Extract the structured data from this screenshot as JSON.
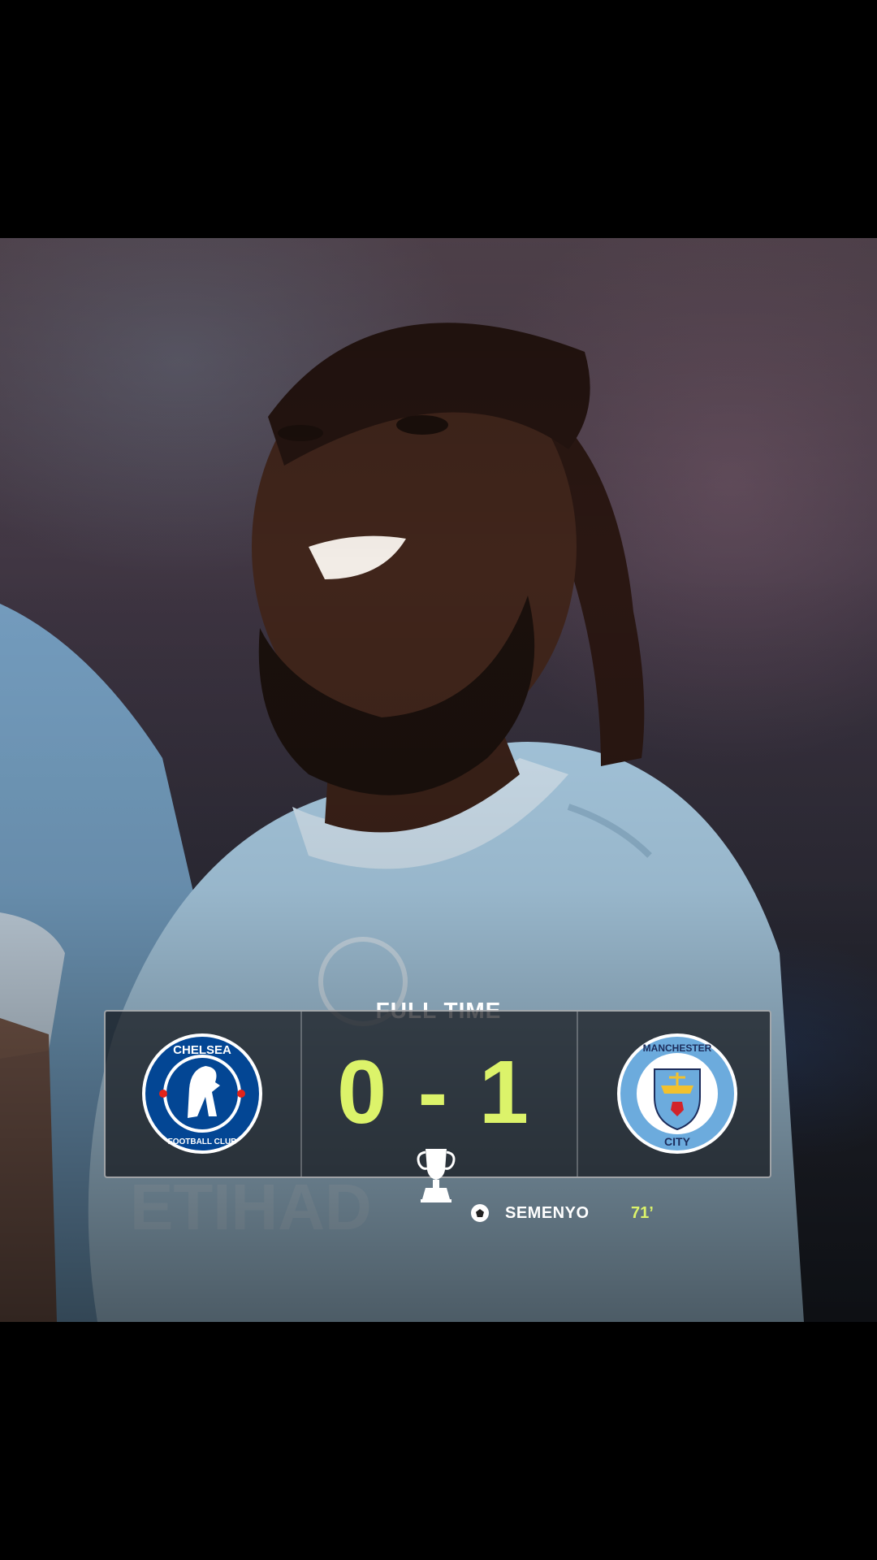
{
  "match": {
    "status_label": "FULL TIME",
    "score": "0 - 1",
    "home_team": {
      "crest_text": "CHELSEA",
      "crest_subtext": "FOOTBALL CLUB",
      "crest_icon": "chelsea-crest-icon"
    },
    "away_team": {
      "crest_text": "MANCHESTER",
      "crest_subtext": "CITY",
      "crest_icon": "manchester-city-crest-icon"
    },
    "competition_icon": "fa-cup-trophy-icon",
    "goals": [
      {
        "icon": "football-icon",
        "scorer": "SEMENYO",
        "minute": "71’"
      }
    ]
  },
  "colors": {
    "accent": "#dcf36a",
    "chelsea_blue": "#034694",
    "city_blue": "#6cabdd",
    "card_bg": "#14161c"
  }
}
